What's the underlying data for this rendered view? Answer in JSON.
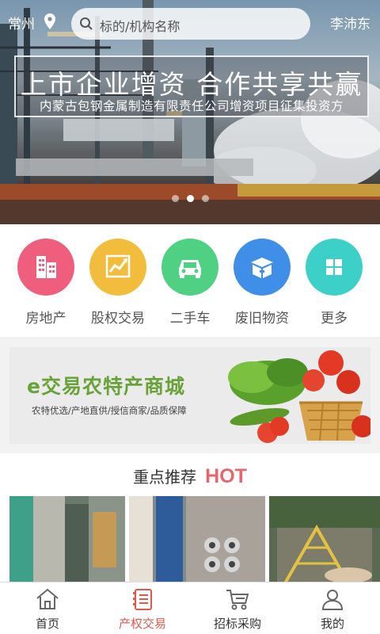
{
  "header": {
    "city": "常州",
    "search_placeholder": "标的/机构名称",
    "user_name": "李沛东"
  },
  "banner": {
    "headline": "上市企业增资 合作共享共赢",
    "subheadline": "内蒙古包钢金属制造有限责任公司增资项目征集投资方",
    "dot_count": 3,
    "active_dot": 1
  },
  "categories": [
    {
      "label": "房地产",
      "icon": "building-icon",
      "color": "#ef5e7c"
    },
    {
      "label": "股权交易",
      "icon": "stock-chart-icon",
      "color": "#f2bd3c"
    },
    {
      "label": "二手车",
      "icon": "car-icon",
      "color": "#4fd082"
    },
    {
      "label": "废旧物资",
      "icon": "box-icon",
      "color": "#3f8fe8"
    },
    {
      "label": "更多",
      "icon": "grid-icon",
      "color": "#3dd0c8"
    }
  ],
  "promo": {
    "title": "e交易农特产商城",
    "subtitle": "农特优选/产地直供/授信商家/品质保障"
  },
  "hot": {
    "title": "重点推荐",
    "badge": "HOT"
  },
  "tabs": [
    {
      "label": "首页",
      "icon": "home-icon",
      "active": false
    },
    {
      "label": "产权交易",
      "icon": "document-icon",
      "active": true
    },
    {
      "label": "招标采购",
      "icon": "cart-icon",
      "active": false
    },
    {
      "label": "我的",
      "icon": "user-icon",
      "active": false
    }
  ],
  "colors": {
    "accent": "#e2574c",
    "hot": "#e8656b",
    "promo_green": "#6aa23a"
  }
}
